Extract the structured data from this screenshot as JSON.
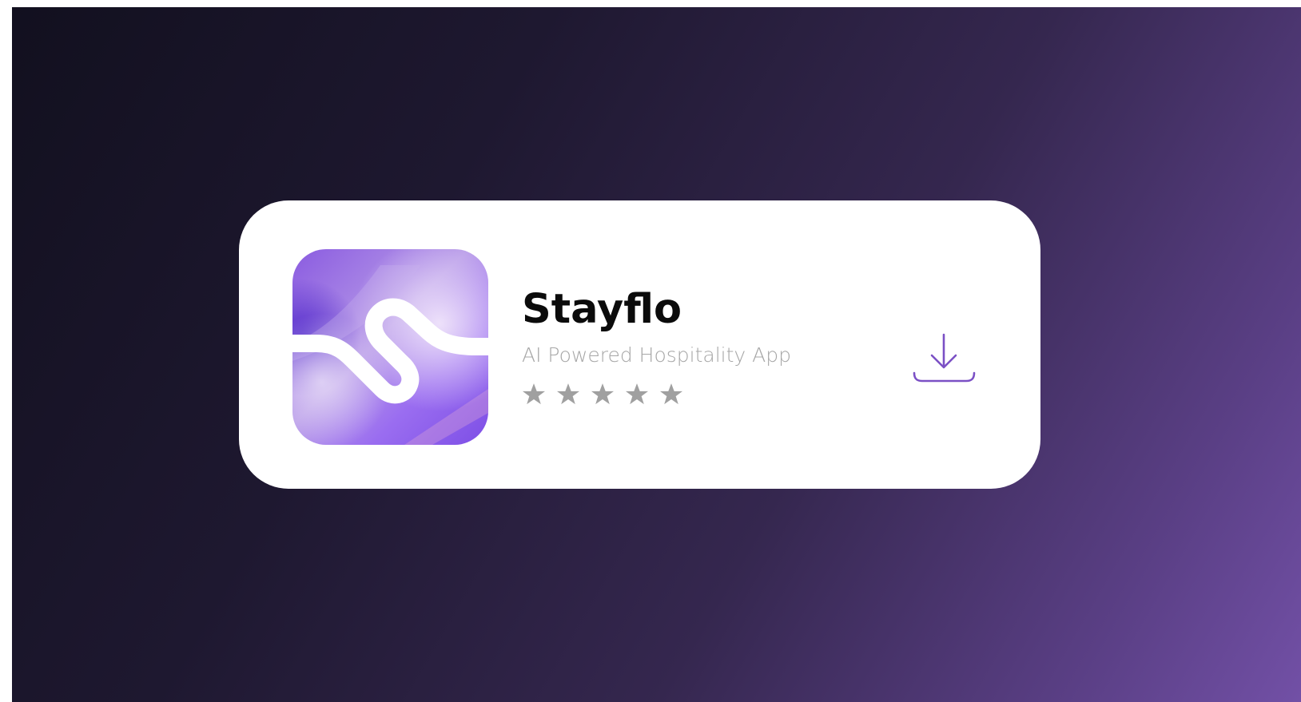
{
  "app": {
    "name": "Stayflo",
    "subtitle": "AI Powered Hospitality App",
    "rating": {
      "value": 5,
      "max": 5,
      "star_color": "#a0a0a0"
    },
    "icon": "stayflo-logo-icon"
  },
  "actions": {
    "download_icon": "download-icon"
  },
  "colors": {
    "accent": "#7b50c5",
    "background_start": "#12101f",
    "background_end": "#7250a6",
    "card": "#ffffff"
  }
}
